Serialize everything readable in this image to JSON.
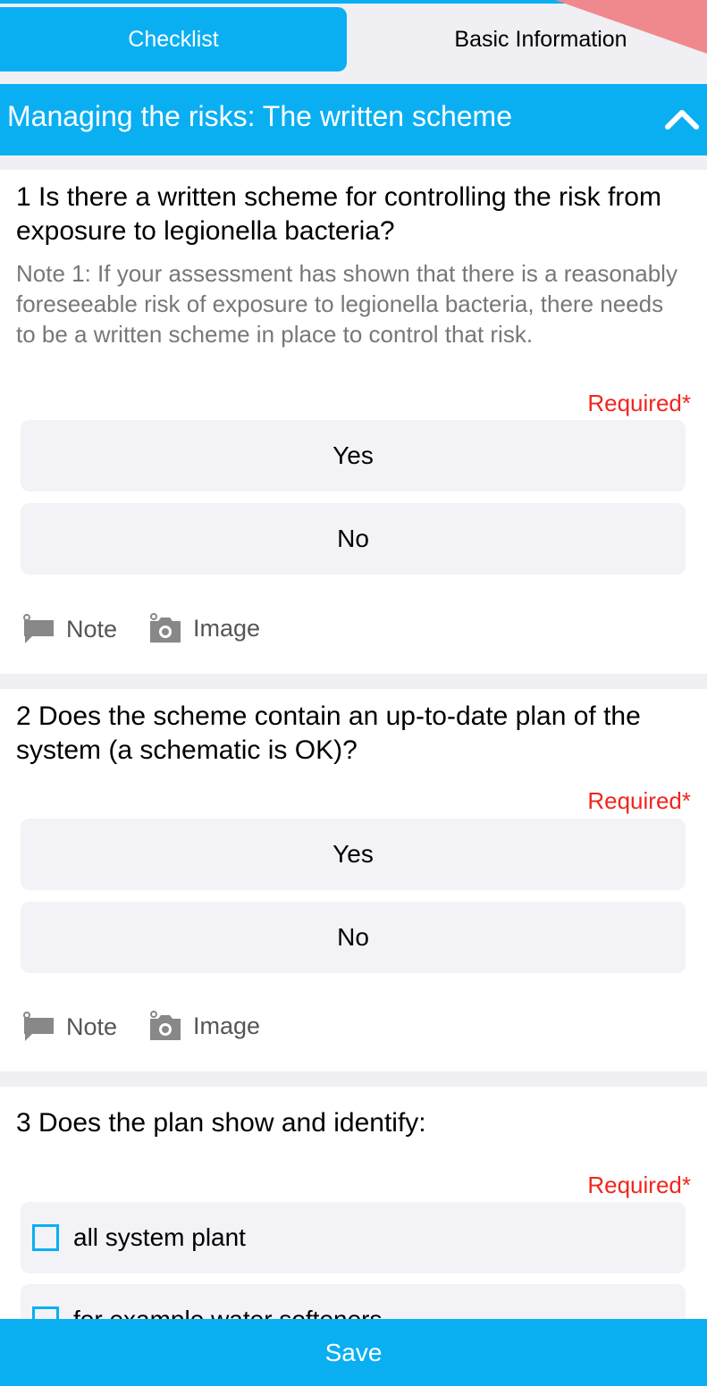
{
  "tabs": {
    "checklist": "Checklist",
    "basic_info": "Basic Information"
  },
  "section": {
    "title": "Managing the risks: The written scheme"
  },
  "questions": [
    {
      "text": "1 Is there a written scheme for controlling the risk from exposure to legionella bacteria?",
      "note": "Note 1: If your assessment has shown that there is a reasonably foreseeable risk of exposure to legionella bacteria, there needs to be a written scheme in place to control that risk.",
      "required": "Required*",
      "options": [
        "Yes",
        "No"
      ],
      "actions": {
        "note": "Note",
        "image": "Image"
      }
    },
    {
      "text": "2 Does the scheme contain an up-to-date plan of the system (a schematic is OK)?",
      "required": "Required*",
      "options": [
        "Yes",
        "No"
      ],
      "actions": {
        "note": "Note",
        "image": "Image"
      }
    },
    {
      "text": "3 Does the plan show and identify:",
      "required": "Required*",
      "checkbox_options": [
        "all system plant",
        "for example water softeners"
      ]
    }
  ],
  "footer": {
    "save": "Save"
  },
  "colors": {
    "accent": "#0aaff2",
    "required": "#f0261e",
    "background": "#efeff4",
    "option_bg": "#f2f2f7"
  }
}
